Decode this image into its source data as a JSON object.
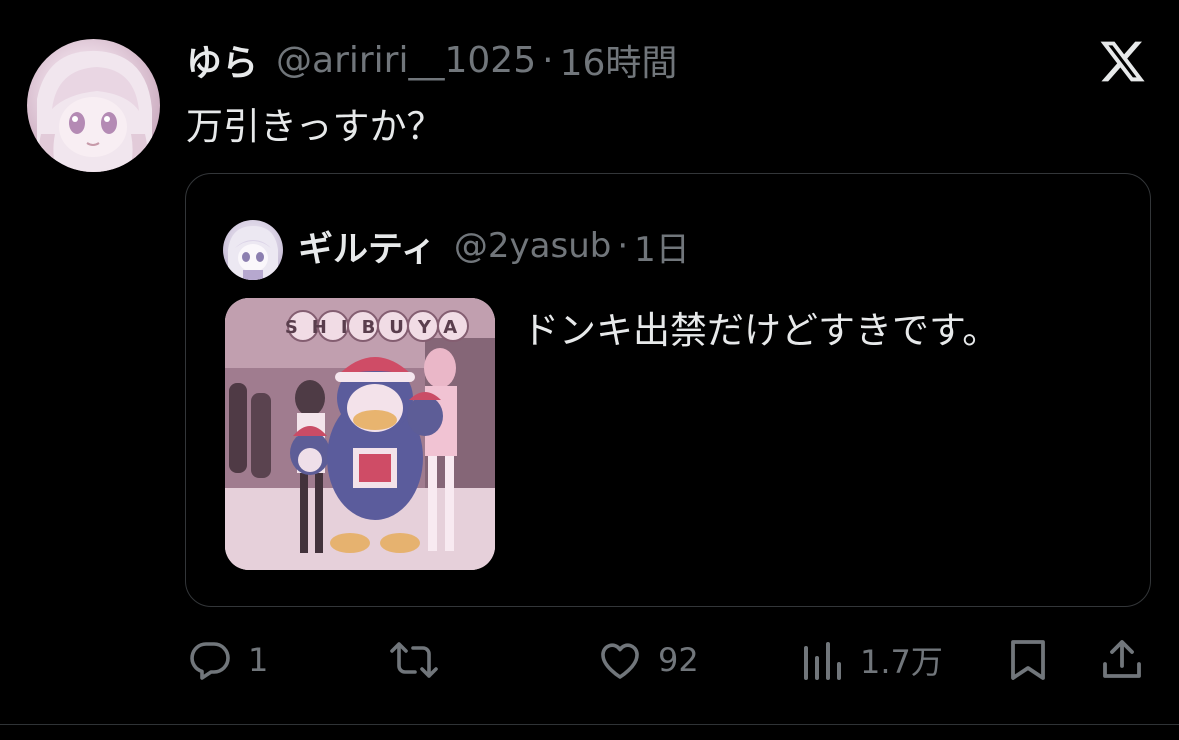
{
  "tweet": {
    "display_name": "ゆら",
    "handle": "@aririri__1025",
    "separator": "·",
    "time": "16時間",
    "text": "万引きっすか？"
  },
  "quoted": {
    "display_name": "ギルティ",
    "handle": "@2yasub",
    "separator": "·",
    "time": "1日",
    "text": "ドンキ出禁だけどすきです。",
    "image_sign_text": "SHIBUYA"
  },
  "actions": {
    "replies": "1",
    "likes": "92",
    "views": "1.7万"
  },
  "icons": {
    "brand": "x-logo-icon",
    "reply": "reply-icon",
    "retweet": "retweet-icon",
    "like": "heart-icon",
    "views": "views-icon",
    "bookmark": "bookmark-icon",
    "share": "share-icon"
  },
  "colors": {
    "background": "#000000",
    "text": "#e7e9ea",
    "muted": "#71767b",
    "border": "#333639"
  }
}
